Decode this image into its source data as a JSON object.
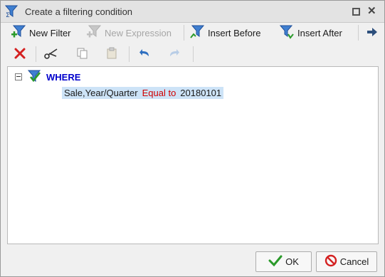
{
  "dialog": {
    "title": "Create a filtering condition"
  },
  "toolbar": {
    "new_filter": "New Filter",
    "new_expression": "New Expression",
    "insert_before": "Insert Before",
    "insert_after": "Insert After"
  },
  "tree": {
    "root_label": "WHERE",
    "condition": {
      "field": "Sale,Year/Quarter",
      "operator": "Equal to",
      "value": "20180101"
    }
  },
  "buttons": {
    "ok": "OK",
    "cancel": "Cancel"
  },
  "colors": {
    "operator": "#d00000",
    "where": "#0000cc",
    "selection": "#cde3f7"
  },
  "icons": [
    "filter-icon",
    "maximize-icon",
    "close-icon",
    "new-filter-icon",
    "new-expression-icon",
    "insert-before-icon",
    "insert-after-icon",
    "more-arrow-icon",
    "delete-icon",
    "cut-icon",
    "copy-icon",
    "paste-icon",
    "undo-icon",
    "redo-icon",
    "check-icon",
    "cancel-icon"
  ]
}
